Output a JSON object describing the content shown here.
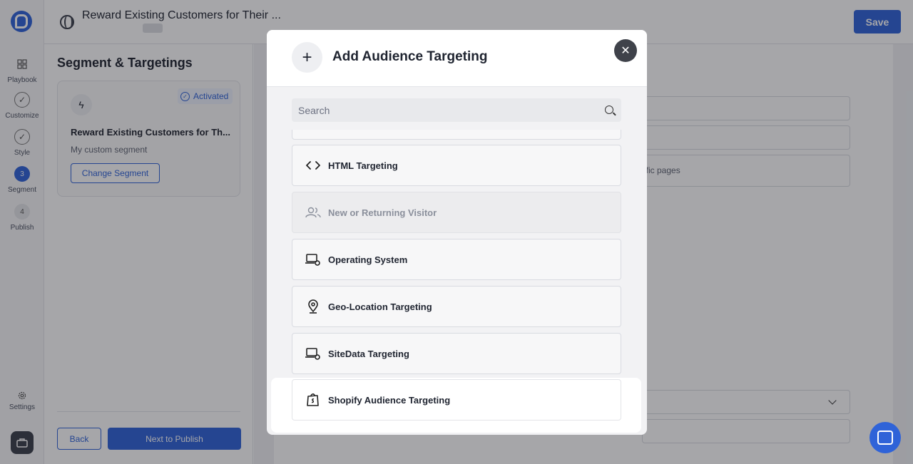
{
  "rail": {
    "steps": [
      {
        "label": "Playbook",
        "icon": "grid-icon"
      },
      {
        "label": "Customize",
        "icon": "check-circle-icon"
      },
      {
        "label": "Style",
        "icon": "check-circle-icon"
      },
      {
        "label": "Segment",
        "number": "3"
      },
      {
        "label": "Publish",
        "number": "4"
      }
    ],
    "settings_label": "Settings"
  },
  "topbar": {
    "title": "Reward Existing Customers for Their ...",
    "save_label": "Save"
  },
  "side_panel": {
    "title": "Segment & Targetings",
    "status": "Activated",
    "segment_name": "Reward Existing Customers for Th...",
    "segment_desc": "My custom segment",
    "change_label": "Change Segment",
    "back_label": "Back",
    "next_label": "Next to Publish"
  },
  "main": {
    "partial_text": "ific pages"
  },
  "modal": {
    "title": "Add Audience Targeting",
    "search_placeholder": "Search",
    "items": [
      {
        "label": "HTML Targeting",
        "icon": "code-icon"
      },
      {
        "label": "New or Returning Visitor",
        "icon": "users-icon",
        "disabled": true
      },
      {
        "label": "Operating System",
        "icon": "laptop-gear-icon"
      },
      {
        "label": "Geo-Location Targeting",
        "icon": "map-pin-icon"
      },
      {
        "label": "SiteData Targeting",
        "icon": "laptop-gear-icon"
      },
      {
        "label": "Shopify Audience Targeting",
        "icon": "shopify-bag-icon",
        "highlighted": true
      }
    ]
  },
  "colors": {
    "primary": "#2f63d8",
    "overlay": "rgba(20,22,30,0.38)"
  }
}
